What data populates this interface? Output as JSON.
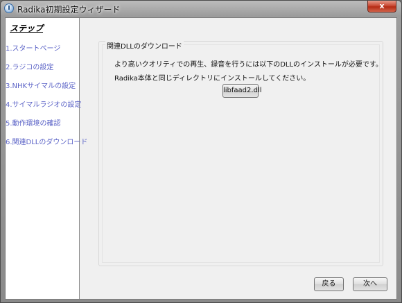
{
  "window": {
    "title": "Radika初期設定ウィザード",
    "close_label": "x"
  },
  "sidebar": {
    "header": "ステップ",
    "steps": [
      {
        "label": "1.スタートページ"
      },
      {
        "label": "2.ラジコの設定"
      },
      {
        "label": "3.NHKサイマルの設定"
      },
      {
        "label": "4.サイマルラジオの設定"
      },
      {
        "label": "5.動作環境の確認"
      },
      {
        "label": "6.関連DLLのダウンロード"
      }
    ]
  },
  "main": {
    "group_title": "関連DLLのダウンロード",
    "line1": "より高いクオリティでの再生、録音を行うには以下のDLLのインストールが必要です。",
    "line2": "Radika本体と同じディレクトリにインストールしてください。",
    "dll_button": "libfaad2.dll"
  },
  "footer": {
    "back_label": "戻る",
    "next_label": "次へ"
  }
}
